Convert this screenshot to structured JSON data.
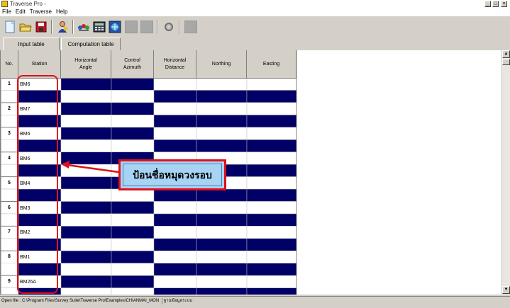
{
  "window": {
    "title": "Traverse Pro -"
  },
  "menu": [
    "File",
    "Edit",
    "Traverse",
    "Help"
  ],
  "toolbar": {
    "buttons": [
      "new-file-icon",
      "open-folder-icon",
      "save-disk-icon",
      "user-wizard-icon",
      "compute-icon",
      "calculator-icon",
      "network-icon",
      "disabled-tool-icon",
      "disabled-tool-icon",
      "settings-icon",
      "disabled-tool-icon"
    ]
  },
  "tabs": {
    "input": "Input table",
    "computation": "Computation table"
  },
  "table": {
    "headers": {
      "no": "No.",
      "station": "Station",
      "horizontal_angle": "Horizontal\nAngle",
      "control_azimuth": "Control\nAzimuth",
      "horizontal_distance": "Horizontal\nDistance",
      "northing": "Northing",
      "easting": "Easting"
    },
    "rows": [
      {
        "no": "1",
        "station": "BM6"
      },
      {
        "no": "2",
        "station": "BM7"
      },
      {
        "no": "3",
        "station": "BM6"
      },
      {
        "no": "4",
        "station": "BM6"
      },
      {
        "no": "5",
        "station": "BM4"
      },
      {
        "no": "6",
        "station": "BM3"
      },
      {
        "no": "7",
        "station": "BM2"
      },
      {
        "no": "8",
        "station": "BM1"
      },
      {
        "no": "9",
        "station": "BM26A"
      }
    ]
  },
  "status": {
    "file": "Open file : C:\\Program Files\\Survey Suite\\Traverse Pro\\Examples\\CHIANMAI_MON",
    "db": "ฐานข้อมูลระบบ"
  },
  "annotation": {
    "callout": "ป้อนชื่อหมุดวงรอบ"
  },
  "colors": {
    "navy": "#000066",
    "annotation_red": "#e0101a",
    "callout_fill": "#a7d3f5"
  }
}
